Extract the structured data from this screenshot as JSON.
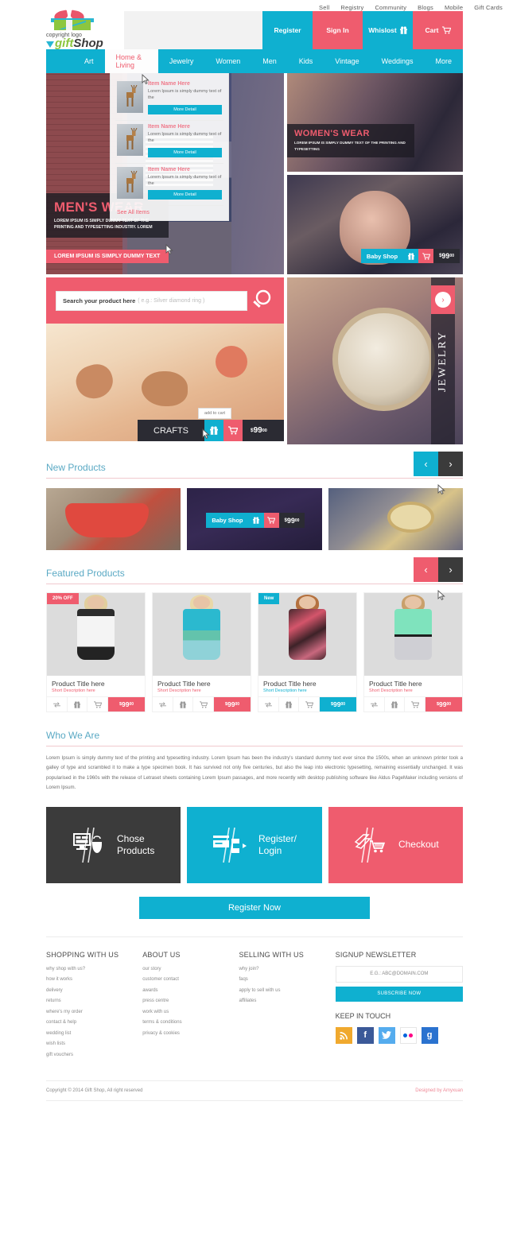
{
  "topbar": {
    "links": [
      "Sell",
      "Registry",
      "Community",
      "Blogs",
      "Mobile",
      "Gift Cards"
    ]
  },
  "logo": {
    "copyright": "copyright logo",
    "gift": "gift",
    "shop": "Shop"
  },
  "header": {
    "register": "Register",
    "signin": "Sign In",
    "wishlist": "Whislost",
    "cart": "Cart"
  },
  "nav": {
    "items": [
      "Art",
      "Home & Living",
      "Jewelry",
      "Women",
      "Men",
      "Kids",
      "Vintage",
      "Weddings",
      "More"
    ],
    "active": "Home & Living"
  },
  "dropdown": {
    "items": [
      {
        "title": "Item Name Here",
        "desc": "Lorem Ipsum is simply dummy text of the",
        "button": "More Detail"
      },
      {
        "title": "Item Name Here",
        "desc": "Lorem Ipsum is simply dummy text of the",
        "button": "More Detail"
      },
      {
        "title": "Item Name Here",
        "desc": "Lorem Ipsum is simply dummy text of the",
        "button": "More Detail"
      }
    ],
    "see_all": "See All Items"
  },
  "hero": {
    "mens": {
      "title": "MEN'S WEAR",
      "subtitle": "LOREM IPSUM IS SIMPLY DUMMY TEXT OF THE PRINTING AND TYPESETTING INDUSTRY. LOREM",
      "bar": "LOREM IPSUM IS SIMPLY DUMMY TEXT"
    },
    "womens": {
      "title": "WOMEN'S WEAR",
      "subtitle": "LOREM IPSUM IS SIMPLY DUMMY TEXT OF THE PRINTING AND TYPESETTING"
    },
    "baby": {
      "label": "Baby Shop",
      "currency": "$",
      "price": "99",
      "cents": "00"
    }
  },
  "search": {
    "label": "Search your product here",
    "placeholder": "( e.g.: Silver diamond ring )"
  },
  "crafts": {
    "title": "CRAFTS",
    "tooltip": "add to cart",
    "currency": "$",
    "price": "99",
    "cents": "00"
  },
  "jewelry": {
    "title": "JEWELRY"
  },
  "new_products": {
    "title": "New Products",
    "cards": [
      {
        "label": "",
        "price": ""
      },
      {
        "label": "Baby Shop",
        "currency": "$",
        "price": "99",
        "cents": "00"
      },
      {
        "label": "",
        "price": ""
      }
    ]
  },
  "featured_products": {
    "title": "Featured Products",
    "items": [
      {
        "badge": "20% OFF",
        "badge_color": "pink",
        "title": "Product Title here",
        "desc": "Short Description here",
        "desc_color": "pink",
        "currency": "$",
        "price": "99",
        "cents": "00",
        "price_color": "pink"
      },
      {
        "badge": "",
        "badge_color": "",
        "title": "Product Title here",
        "desc": "Short Description here",
        "desc_color": "pink",
        "currency": "$",
        "price": "99",
        "cents": "00",
        "price_color": "pink"
      },
      {
        "badge": "New",
        "badge_color": "cyan",
        "title": "Product Title here",
        "desc": "Short Description here",
        "desc_color": "cyan",
        "currency": "$",
        "price": "99",
        "cents": "00",
        "price_color": "cyan"
      },
      {
        "badge": "",
        "badge_color": "",
        "title": "Product Title here",
        "desc": "Short Description here",
        "desc_color": "pink",
        "currency": "$",
        "price": "99",
        "cents": "00",
        "price_color": "pink"
      }
    ]
  },
  "who_we_are": {
    "title": "Who We Are",
    "body": "Lorem Ipsum is simply dummy text of the printing and typesetting industry. Lorem Ipsum has been the industry's standard dummy text ever since the 1500s, when an unknown printer took a galley of type and scrambled it to make a type specimen book. It has survived not only five centuries, but also the leap into electronic typesetting, remaining essentially unchanged. It was popularised in the 1960s with the release of Letraset sheets containing Lorem Ipsum passages, and more recently with desktop publishing software like Aldus PageMaker including versions of Lorem Ipsum."
  },
  "process": {
    "steps": [
      {
        "label": "Chose\nProducts",
        "line1": "Chose",
        "line2": "Products",
        "color": "dark"
      },
      {
        "label": "Register/ Login",
        "line1": "Register/",
        "line2": "Login",
        "color": "cyan"
      },
      {
        "label": "Checkout",
        "line1": "Checkout",
        "line2": "",
        "color": "pink"
      }
    ],
    "register_button": "Register Now"
  },
  "footer": {
    "columns": [
      {
        "heading": "SHOPPING WITH US",
        "links": [
          "why shop with us?",
          "how it works",
          "delivery",
          "returns",
          "where's my order",
          "contact & help",
          "wedding list",
          "wish lists",
          "gift vouchers"
        ]
      },
      {
        "heading": "ABOUT US",
        "links": [
          "our story",
          "customer contact",
          "awards",
          "press centre",
          "work with us",
          "terms & conditions",
          "privacy & cookies"
        ]
      },
      {
        "heading": "SELLING WITH US",
        "links": [
          "why join?",
          "faqs",
          "apply to sell with us",
          "affiliates"
        ]
      }
    ],
    "newsletter": {
      "heading": "SIGNUP NEWSLETTER",
      "placeholder": "E.G.: ABC@DOMAIN.COM",
      "button": "SUBSCRIBE NOW"
    },
    "keep_in_touch": {
      "heading": "KEEP IN TOUCH",
      "icons": [
        "rss-icon",
        "facebook-icon",
        "twitter-icon",
        "flickr-icon",
        "google-plus-icon"
      ]
    },
    "copyright": "Copyright © 2014 Gift Shop, All right reserved",
    "designed_by_prefix": "Designed by ",
    "designed_by": "Amyxuan"
  },
  "colors": {
    "cyan": "#0fb0d0",
    "pink": "#ef5c6e",
    "dark": "#3b3b3b"
  }
}
